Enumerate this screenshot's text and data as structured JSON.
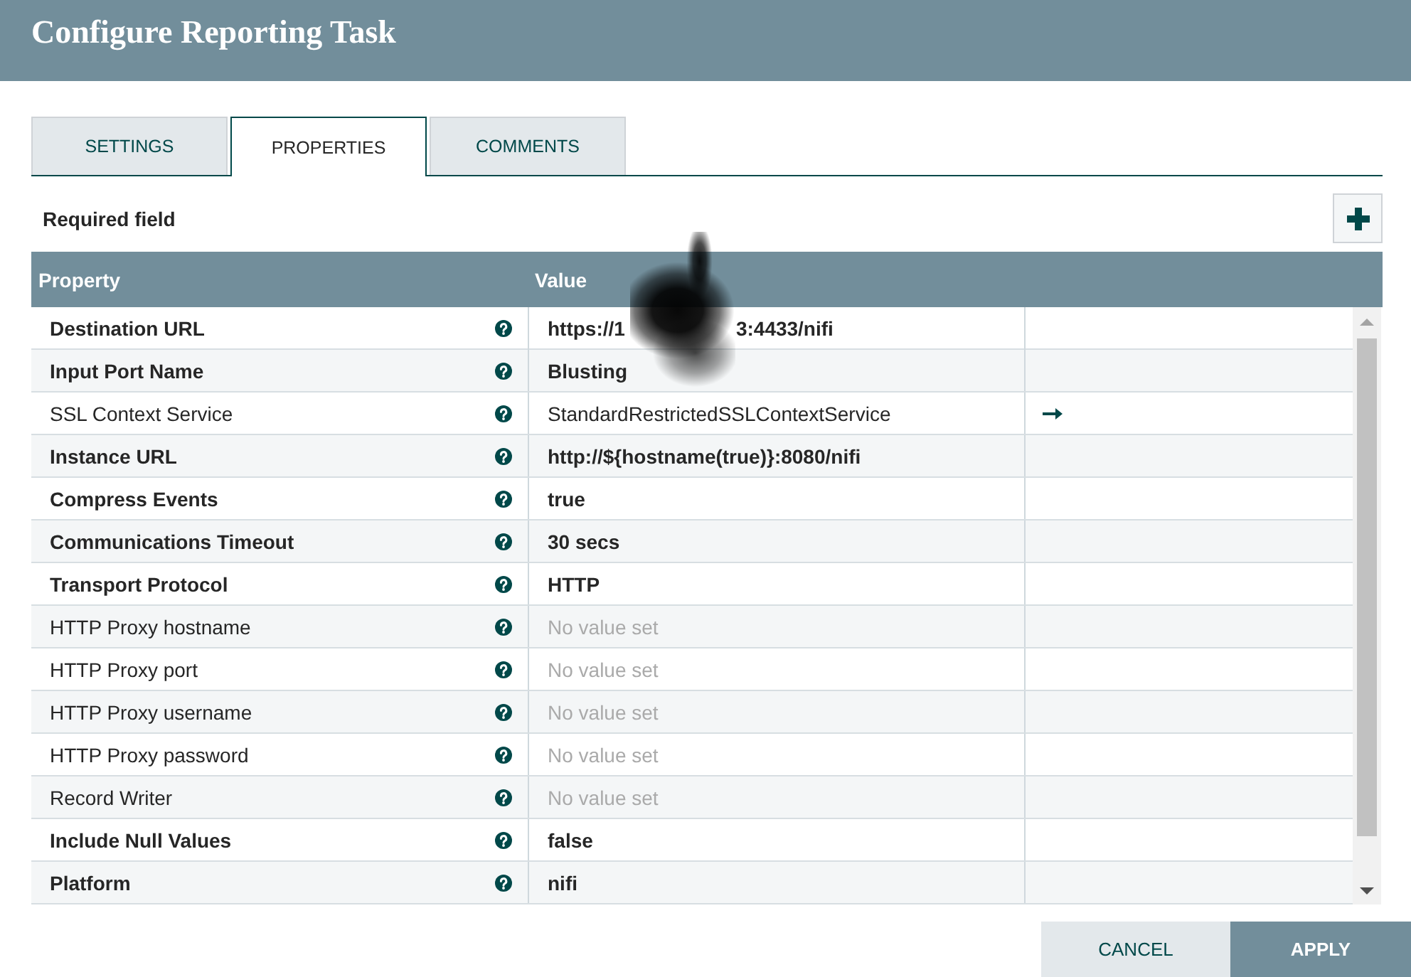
{
  "dialog": {
    "title": "Configure Reporting Task"
  },
  "tabs": [
    {
      "label": "SETTINGS",
      "selected": false
    },
    {
      "label": "PROPERTIES",
      "selected": true
    },
    {
      "label": "COMMENTS",
      "selected": false
    }
  ],
  "required_note": "Required field",
  "table": {
    "columns": [
      "Property",
      "Value"
    ],
    "rows": [
      {
        "property": "Destination URL",
        "required": true,
        "value": "https://1",
        "redacted": true,
        "value_tail": "3:4433/nifi",
        "value_set": true,
        "link_arrow": false
      },
      {
        "property": "Input Port Name",
        "required": true,
        "value": "Blusting",
        "redacted": false,
        "value_set": true,
        "link_arrow": false
      },
      {
        "property": "SSL Context Service",
        "required": false,
        "value": "StandardRestrictedSSLContextService",
        "redacted": false,
        "value_set": true,
        "link_arrow": true
      },
      {
        "property": "Instance URL",
        "required": true,
        "value": "http://${hostname(true)}:8080/nifi",
        "redacted": false,
        "value_set": true,
        "link_arrow": false
      },
      {
        "property": "Compress Events",
        "required": true,
        "value": "true",
        "redacted": false,
        "value_set": true,
        "link_arrow": false
      },
      {
        "property": "Communications Timeout",
        "required": true,
        "value": "30 secs",
        "redacted": false,
        "value_set": true,
        "link_arrow": false
      },
      {
        "property": "Transport Protocol",
        "required": true,
        "value": "HTTP",
        "redacted": false,
        "value_set": true,
        "link_arrow": false
      },
      {
        "property": "HTTP Proxy hostname",
        "required": false,
        "value": "No value set",
        "redacted": false,
        "value_set": false,
        "link_arrow": false
      },
      {
        "property": "HTTP Proxy port",
        "required": false,
        "value": "No value set",
        "redacted": false,
        "value_set": false,
        "link_arrow": false
      },
      {
        "property": "HTTP Proxy username",
        "required": false,
        "value": "No value set",
        "redacted": false,
        "value_set": false,
        "link_arrow": false
      },
      {
        "property": "HTTP Proxy password",
        "required": false,
        "value": "No value set",
        "redacted": false,
        "value_set": false,
        "link_arrow": false
      },
      {
        "property": "Record Writer",
        "required": false,
        "value": "No value set",
        "redacted": false,
        "value_set": false,
        "link_arrow": false
      },
      {
        "property": "Include Null Values",
        "required": true,
        "value": "false",
        "redacted": false,
        "value_set": true,
        "link_arrow": false
      },
      {
        "property": "Platform",
        "required": true,
        "value": "nifi",
        "redacted": false,
        "value_set": true,
        "link_arrow": false
      }
    ]
  },
  "buttons": [
    {
      "label": "CANCEL",
      "kind": "secondary"
    },
    {
      "label": "APPLY",
      "kind": "primary"
    }
  ]
}
